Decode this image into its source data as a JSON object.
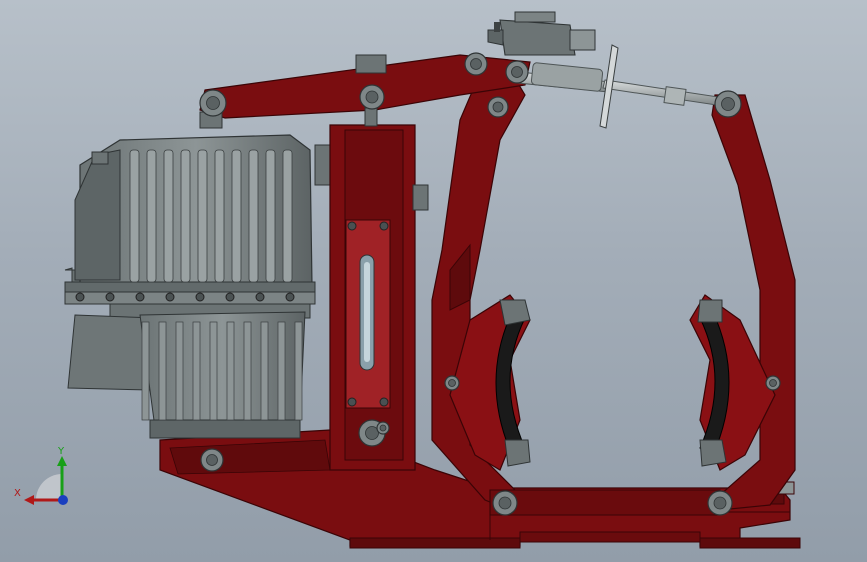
{
  "viewport": {
    "background_top": "#b7c0c9",
    "background_bottom": "#929da9"
  },
  "model": {
    "frame_color": "#7a0d10",
    "frame_dark": "#4d0608",
    "steel_color": "#7f8788",
    "steel_dark": "#454b4c",
    "lining_color": "#1a1a1a"
  },
  "triad": {
    "x_label": "X",
    "y_label": "Y",
    "x_color": "#b01818",
    "y_color": "#18a018",
    "z_color": "#1a3fbf"
  }
}
